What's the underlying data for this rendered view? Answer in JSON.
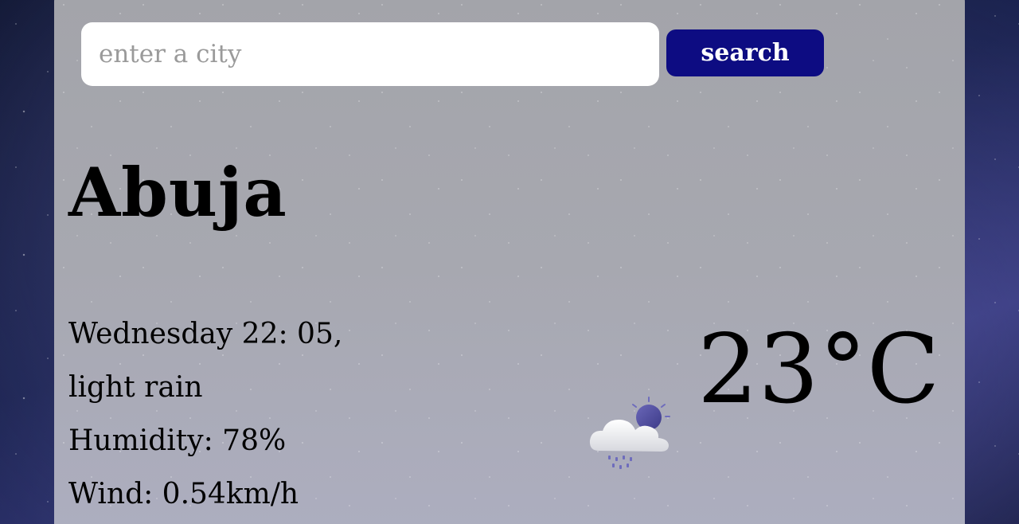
{
  "search": {
    "placeholder": "enter a city",
    "value": "",
    "button_label": "search",
    "button_color": "#0d0c82"
  },
  "weather": {
    "city": "Abuja",
    "datetime": "Wednesday 22: 05,",
    "description": "light rain",
    "humidity": "Humidity: 78%",
    "wind": "Wind: 0.54km/h",
    "temperature": "23°C",
    "icon": "light-rain-night-icon"
  }
}
